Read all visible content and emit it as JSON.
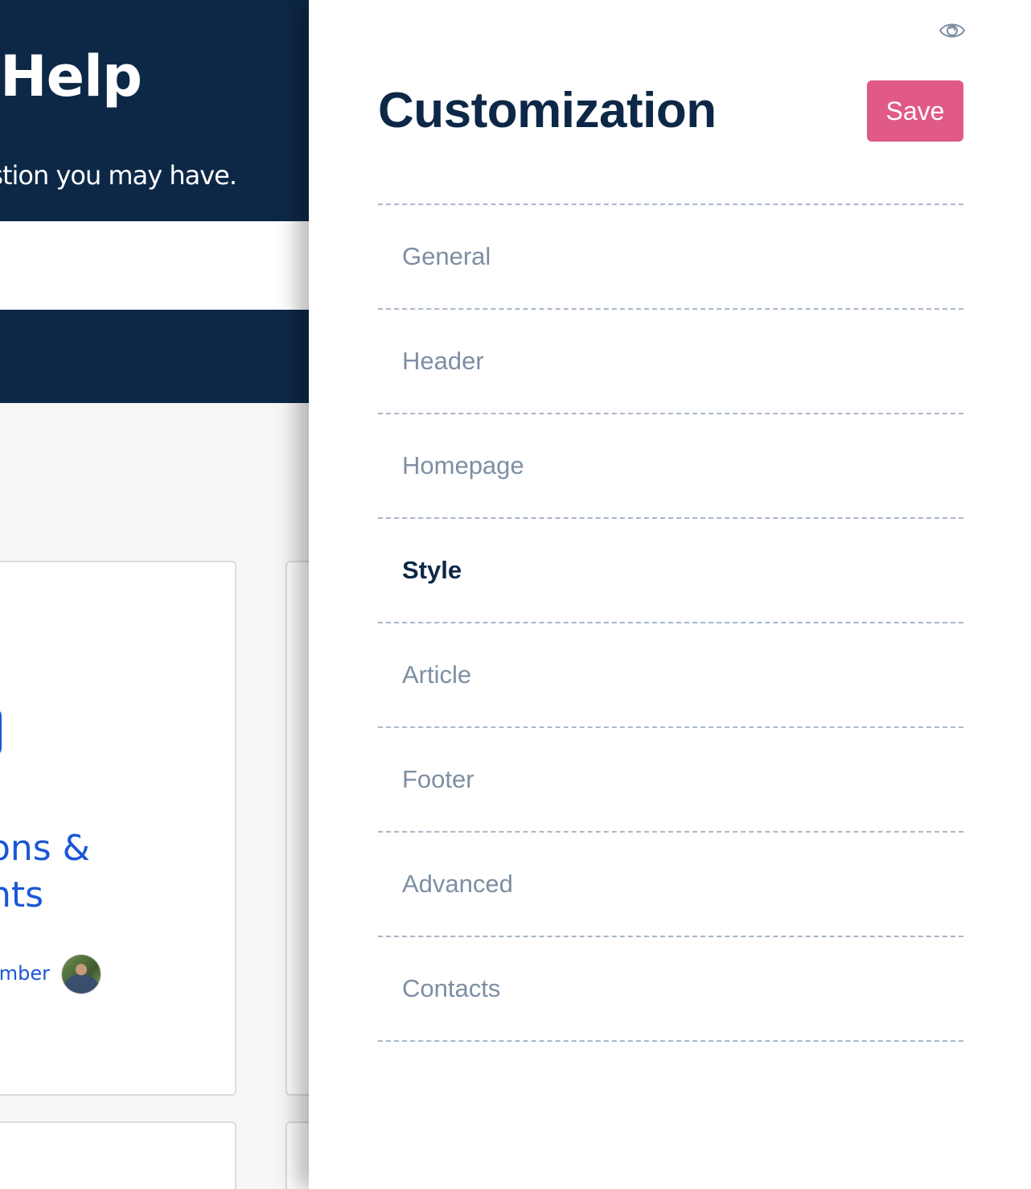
{
  "background_page": {
    "hero_title": "Help",
    "hero_subtitle": "stion you may have.",
    "card": {
      "title_line1": "ons &",
      "title_line2": "nts",
      "author": "ember"
    }
  },
  "panel": {
    "title": "Customization",
    "save_label": "Save",
    "preview_icon": "eye-icon",
    "active_item": "Style",
    "menu_items": [
      {
        "label": "General"
      },
      {
        "label": "Header"
      },
      {
        "label": "Homepage"
      },
      {
        "label": "Style"
      },
      {
        "label": "Article"
      },
      {
        "label": "Footer"
      },
      {
        "label": "Advanced"
      },
      {
        "label": "Contacts"
      }
    ]
  },
  "colors": {
    "navy": "#0d2847",
    "accent_pink": "#e05a85",
    "menu_text": "#7d8fa3",
    "link_blue": "#1a57d6",
    "divider": "#a9b8c8"
  }
}
